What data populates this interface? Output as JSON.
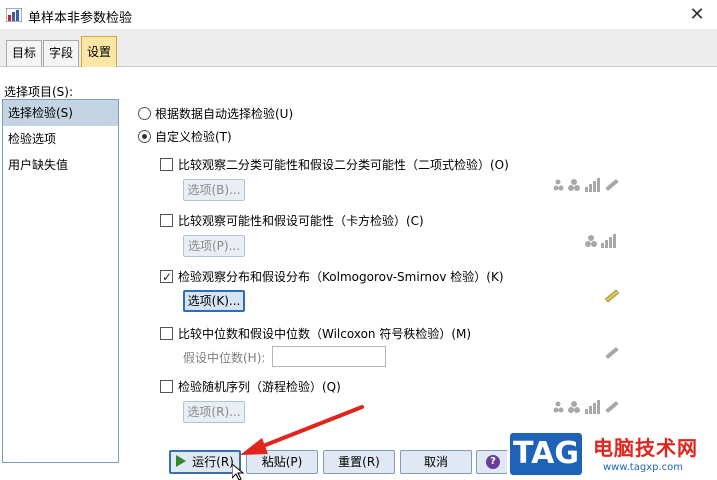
{
  "window": {
    "title": "单样本非参数检验",
    "close_glyph": "✕"
  },
  "tabs": [
    {
      "label": "目标",
      "active": false
    },
    {
      "label": "字段",
      "active": false
    },
    {
      "label": "设置",
      "active": true
    }
  ],
  "sidebar": {
    "label": "选择项目(S):",
    "items": [
      {
        "label": "选择检验(S)",
        "active": true
      },
      {
        "label": "检验选项",
        "active": false
      },
      {
        "label": "用户缺失值",
        "active": false
      }
    ]
  },
  "mode": {
    "auto_label": "根据数据自动选择检验(U)",
    "custom_label": "自定义检验(T)",
    "selected": "custom"
  },
  "tests": {
    "binomial": {
      "label": "比较观察二分类可能性和假设二分类可能性（二项式检验）(O)",
      "checked": false,
      "options_label": "选项(B)..."
    },
    "chisq": {
      "label": "比较观察可能性和假设可能性（卡方检验）(C)",
      "checked": false,
      "options_label": "选项(P)..."
    },
    "ks": {
      "label": "检验观察分布和假设分布（Kolmogorov-Smirnov 检验）(K)",
      "checked": true,
      "options_label": "选项(K)..."
    },
    "wilcoxon": {
      "label": "比较中位数和假设中位数（Wilcoxon 符号秩检验）(M)",
      "checked": false,
      "median_label": "假设中位数(H):",
      "median_value": ""
    },
    "runs": {
      "label": "检验随机序列（游程检验）(Q)",
      "checked": false,
      "options_label": "选项(R)..."
    }
  },
  "buttons": {
    "run": "运行(R)",
    "paste": "粘贴(P)",
    "reset": "重置(R)",
    "cancel": "取消",
    "help": "?"
  },
  "watermark": {
    "tag": "TAG",
    "site_name": "电脑技术网",
    "url": "www.tagxp.com"
  },
  "colors": {
    "active_tab": "#fbe6a6",
    "selected_item": "#c4d4e3",
    "arrow": "#e0261c",
    "brand_blue": "#1e63b8",
    "brand_red": "#e0261c"
  }
}
